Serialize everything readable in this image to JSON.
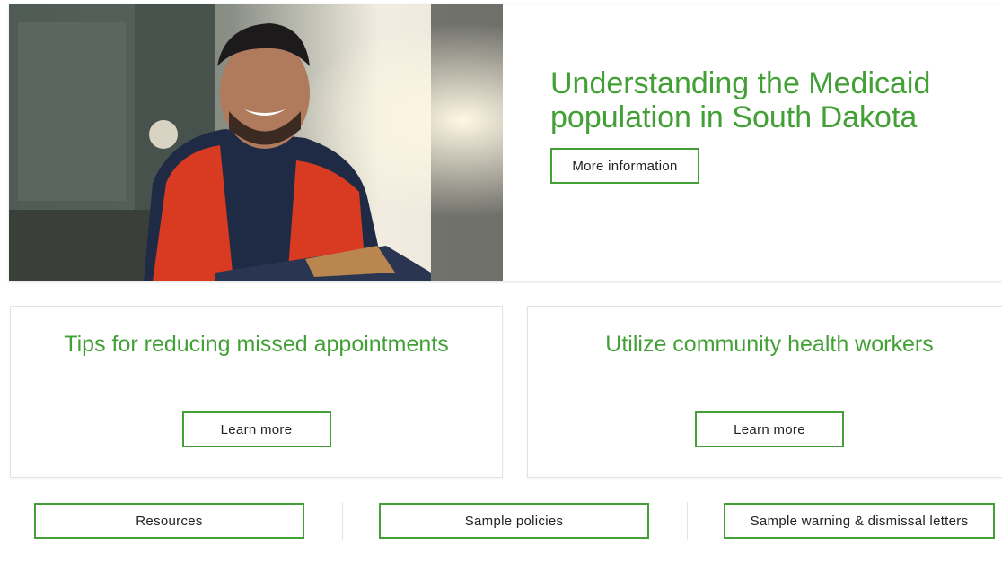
{
  "hero": {
    "title": "Understanding the Medicaid population in South Dakota",
    "button_label": "More information",
    "image_alt": "Smiling man in red vest standing in front of a truck"
  },
  "cards": [
    {
      "title": "Tips for reducing missed appointments",
      "button_label": "Learn more"
    },
    {
      "title": "Utilize community health workers",
      "button_label": "Learn more"
    }
  ],
  "links": {
    "resources": "Resources",
    "sample_policies": "Sample policies",
    "sample_letters": "Sample warning & dismissal letters"
  },
  "colors": {
    "accent": "#43a036",
    "border": "#e3e3e3"
  }
}
